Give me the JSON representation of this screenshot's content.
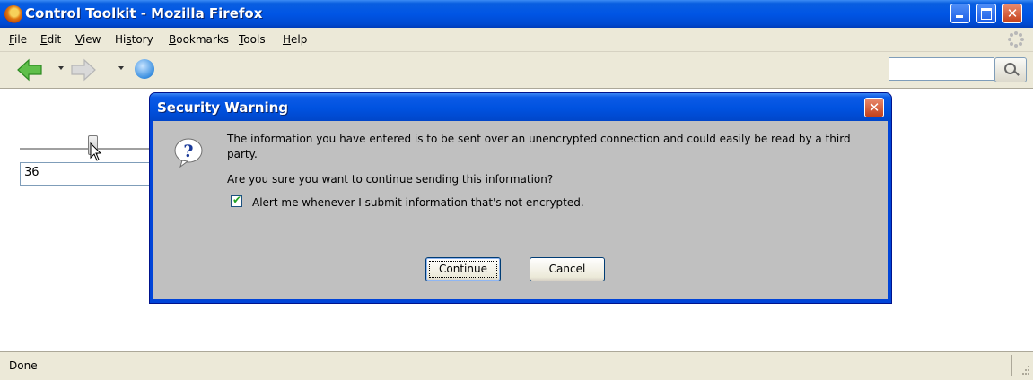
{
  "window": {
    "title": "Control Toolkit - Mozilla Firefox",
    "controls": [
      "minimize-icon",
      "maximize-icon",
      "close-icon"
    ]
  },
  "menu": {
    "items": [
      {
        "label": "File",
        "access": "F"
      },
      {
        "label": "Edit",
        "access": "E"
      },
      {
        "label": "View",
        "access": "V"
      },
      {
        "label": "History",
        "access": "s"
      },
      {
        "label": "Bookmarks",
        "access": "B"
      },
      {
        "label": "Tools",
        "access": "T"
      },
      {
        "label": "Help",
        "access": "H"
      }
    ]
  },
  "toolbar": {
    "icons": [
      "back-arrow-icon",
      "forward-arrow-icon",
      "reload-icon",
      "search-magnifier-icon"
    ],
    "back_color": "#4caf50"
  },
  "page": {
    "slider_fraction": 0.55,
    "input_value": "36"
  },
  "dialog": {
    "title": "Security Warning",
    "icon": "question-icon",
    "message": "The information you have entered is to be sent over an unencrypted connection and could easily be read by a third party.",
    "question": "Are you sure you want to continue sending this information?",
    "checkbox_label": "Alert me whenever I submit information that's not encrypted.",
    "checkbox_checked": true,
    "continue_label": "Continue",
    "cancel_label": "Cancel"
  },
  "status": {
    "text": "Done"
  }
}
